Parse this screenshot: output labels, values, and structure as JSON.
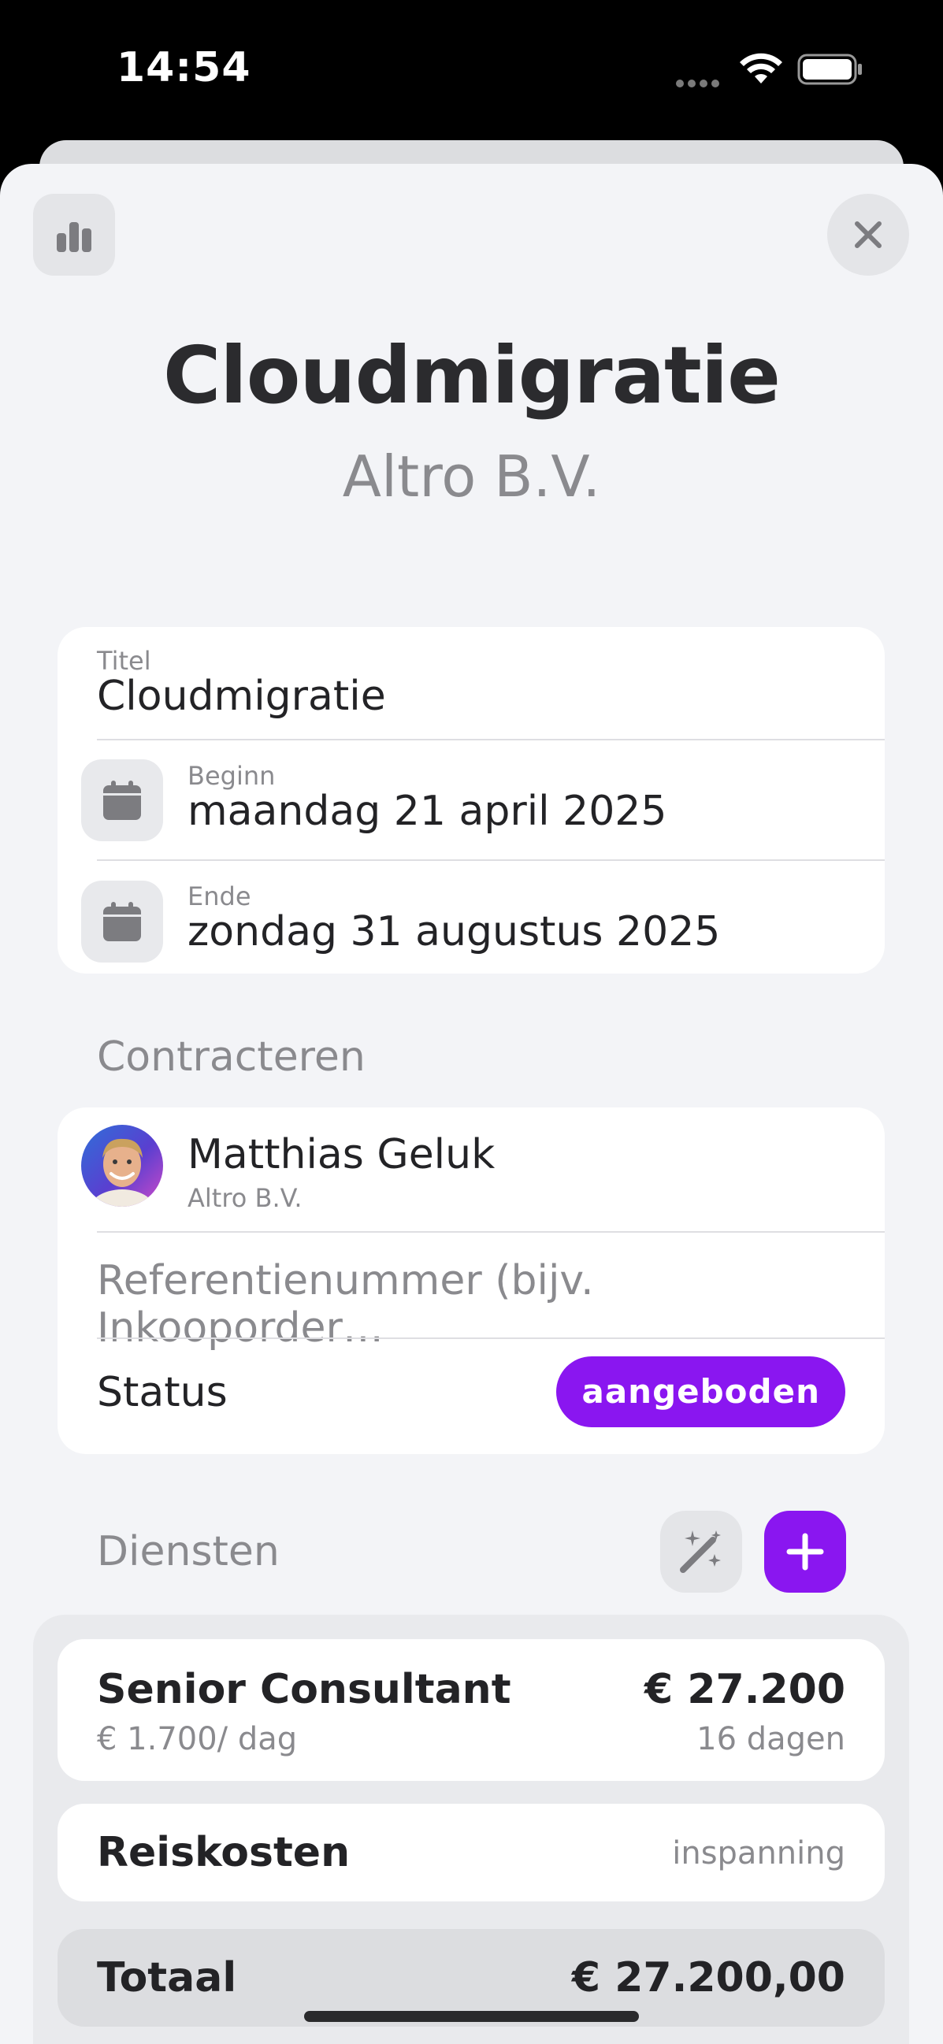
{
  "status_bar": {
    "time": "14:54"
  },
  "header": {
    "title": "Cloudmigratie",
    "subtitle": "Altro B.V."
  },
  "details": {
    "title_label": "Titel",
    "title_value": "Cloudmigratie",
    "start_label": "Beginn",
    "start_value": "maandag 21 april 2025",
    "end_label": "Ende",
    "end_value": "zondag 31 augustus 2025"
  },
  "contract": {
    "section_label": "Contracteren",
    "contact_name": "Matthias Geluk",
    "contact_company": "Altro B.V.",
    "reference_placeholder": "Referentienummer (bijv. Inkooporder…",
    "status_label": "Status",
    "status_value": "aangeboden"
  },
  "services": {
    "section_label": "Diensten",
    "items": [
      {
        "name": "Senior Consultant",
        "rate": "€ 1.700/ dag",
        "amount": "€ 27.200",
        "quantity": "16 dagen"
      },
      {
        "name": "Reiskosten",
        "amount": "inspanning"
      }
    ],
    "total_label": "Totaal",
    "total_value": "€ 27.200,00"
  },
  "colors": {
    "accent": "#8a16f0",
    "background": "#f3f4f7",
    "card": "#ffffff",
    "secondary_text": "#8a8a8e"
  },
  "icons": [
    "chart-bar-icon",
    "close-icon",
    "calendar-icon",
    "magic-wand-icon",
    "plus-icon",
    "wifi-icon",
    "battery-icon",
    "signal-dots-icon"
  ]
}
